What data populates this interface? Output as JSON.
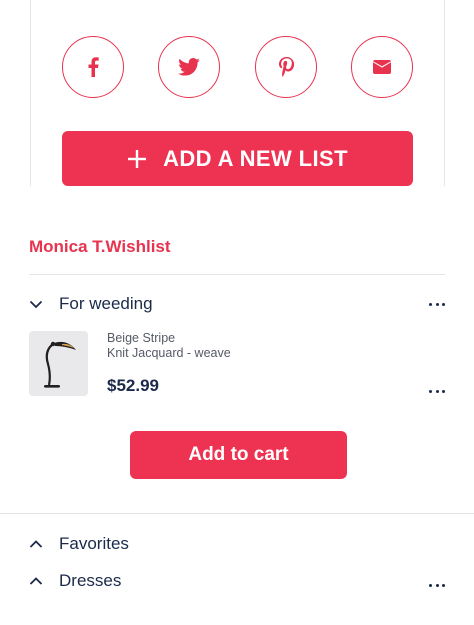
{
  "share": {
    "icons": [
      "facebook-icon",
      "twitter-icon",
      "pinterest-icon",
      "mail-icon"
    ],
    "accent": "#e8334f"
  },
  "add_list": {
    "label": "ADD A NEW LIST",
    "icon": "plus-icon",
    "color": "#ee3352"
  },
  "wishlist": {
    "title": "Monica T.Wishlist",
    "groups": [
      {
        "label": "For weeding",
        "expanded": true
      },
      {
        "label": "Favorites",
        "expanded": false
      },
      {
        "label": "Dresses",
        "expanded": false
      }
    ],
    "item": {
      "name": "Beige Stripe",
      "subtitle": "Knit Jacquard - weave",
      "price": "$52.99",
      "image": "desk-lamp-thumbnail"
    },
    "add_to_cart": "Add to cart"
  }
}
